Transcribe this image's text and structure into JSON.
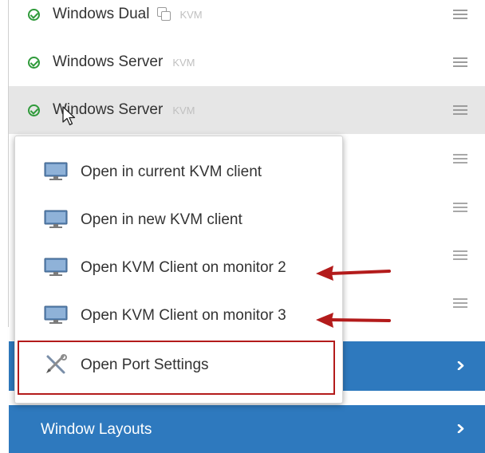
{
  "port_list": {
    "items": [
      {
        "label": "Windows Dual",
        "tag": "KVM",
        "status": "online",
        "dual": true
      },
      {
        "label": "Windows Server",
        "tag": "KVM",
        "status": "online"
      },
      {
        "label": "Windows Server",
        "tag": "KVM",
        "status": "online",
        "hovered": true
      }
    ]
  },
  "context_menu": {
    "items": [
      {
        "label": "Open in current KVM client",
        "icon": "monitor-icon"
      },
      {
        "label": "Open in new KVM client",
        "icon": "monitor-icon"
      },
      {
        "label": "Open KVM Client on monitor 2",
        "icon": "monitor-icon"
      },
      {
        "label": "Open KVM Client on monitor 3",
        "icon": "monitor-icon"
      },
      {
        "label": "Open Port Settings",
        "icon": "tools-icon"
      }
    ]
  },
  "sections": {
    "window_layouts": "Window Layouts"
  },
  "colors": {
    "accent_blue": "#2e79be",
    "status_green": "#2f9a3a",
    "annotation_red": "#b31b1b"
  }
}
